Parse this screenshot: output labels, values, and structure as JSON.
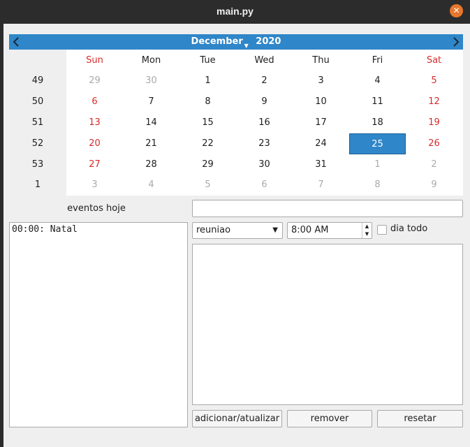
{
  "window": {
    "title": "main.py"
  },
  "calendar": {
    "month": "December",
    "year": "2020",
    "weekday_headers": [
      "Sun",
      "Mon",
      "Tue",
      "Wed",
      "Thu",
      "Fri",
      "Sat"
    ],
    "weeks": [
      {
        "num": "49",
        "days": [
          "29",
          "30",
          "1",
          "2",
          "3",
          "4",
          "5"
        ]
      },
      {
        "num": "50",
        "days": [
          "6",
          "7",
          "8",
          "9",
          "10",
          "11",
          "12"
        ]
      },
      {
        "num": "51",
        "days": [
          "13",
          "14",
          "15",
          "16",
          "17",
          "18",
          "19"
        ]
      },
      {
        "num": "52",
        "days": [
          "20",
          "21",
          "22",
          "23",
          "24",
          "25",
          "26"
        ]
      },
      {
        "num": "53",
        "days": [
          "27",
          "28",
          "29",
          "30",
          "31",
          "1",
          "2"
        ]
      },
      {
        "num": "1",
        "days": [
          "3",
          "4",
          "5",
          "6",
          "7",
          "8",
          "9"
        ]
      }
    ],
    "selected_day": "25",
    "colors": {
      "header_bg": "#2f86c8",
      "weekend": "#d82b2b",
      "other_month": "#aaaaaa",
      "selected_bg": "#2f86c8"
    }
  },
  "events": {
    "label": "eventos hoje",
    "items": [
      "00:00: Natal"
    ]
  },
  "form": {
    "title_value": "",
    "type_selected": "reuniao",
    "time_value": "8:00 AM",
    "all_day_label": "dia todo",
    "all_day_checked": false,
    "description_value": ""
  },
  "buttons": {
    "add_update": "adicionar/atualizar",
    "remove": "remover",
    "reset": "resetar"
  }
}
